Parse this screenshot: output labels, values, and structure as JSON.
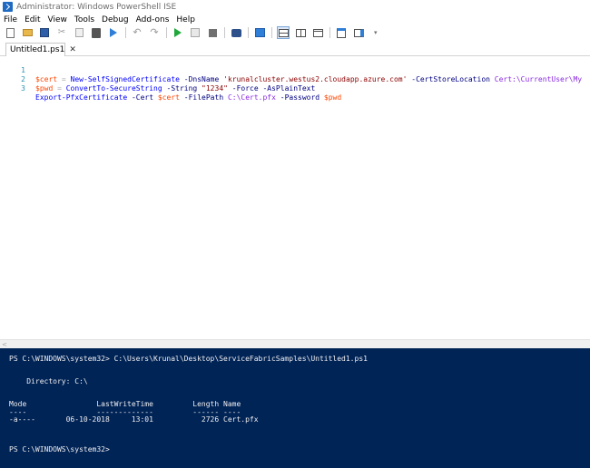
{
  "window": {
    "title": "Administrator: Windows PowerShell ISE"
  },
  "menu": [
    "File",
    "Edit",
    "View",
    "Tools",
    "Debug",
    "Add-ons",
    "Help"
  ],
  "toolbar": {
    "icons": [
      "new-file-icon",
      "open-folder-icon",
      "save-icon",
      "cut-icon",
      "copy-icon",
      "paste-icon",
      "run-selection-icon",
      "undo-icon",
      "redo-icon",
      "run-script-icon",
      "run-selection-icon",
      "stop-icon",
      "debug-icon",
      "remote-powershell-icon",
      "pane-top-icon",
      "pane-right-icon",
      "pane-max-icon",
      "command-window-icon",
      "add-on-tools-icon"
    ]
  },
  "tabs": [
    {
      "label": "Untitled1.ps1",
      "close": "✕"
    }
  ],
  "editor": {
    "lines": [
      {
        "number": "1",
        "tokens": [
          {
            "t": "$cert",
            "k": "var"
          },
          {
            "t": " = ",
            "k": "op"
          },
          {
            "t": "New-SelfSignedCertificate",
            "k": "cmd"
          },
          {
            "t": " -DnsName ",
            "k": "param"
          },
          {
            "t": "'krunalcluster.westus2.cloudapp.azure.com'",
            "k": "str"
          },
          {
            "t": " -CertStoreLocation ",
            "k": "param"
          },
          {
            "t": "Cert:\\CurrentUser\\My",
            "k": "arg"
          }
        ]
      },
      {
        "number": "2",
        "tokens": [
          {
            "t": "$pwd",
            "k": "var"
          },
          {
            "t": " = ",
            "k": "op"
          },
          {
            "t": "ConvertTo-SecureString",
            "k": "cmd"
          },
          {
            "t": " -String ",
            "k": "param"
          },
          {
            "t": "\"1234\"",
            "k": "str"
          },
          {
            "t": " -Force -AsPlainText",
            "k": "param"
          }
        ]
      },
      {
        "number": "3",
        "tokens": [
          {
            "t": "Export-PfxCertificate",
            "k": "cmd"
          },
          {
            "t": " -Cert ",
            "k": "param"
          },
          {
            "t": "$cert",
            "k": "var"
          },
          {
            "t": " -FilePath ",
            "k": "param"
          },
          {
            "t": "C:\\Cert.pfx",
            "k": "arg"
          },
          {
            "t": " -Password ",
            "k": "param"
          },
          {
            "t": "$pwd",
            "k": "var"
          }
        ]
      }
    ]
  },
  "scrollbar": {
    "left_arrow": "<"
  },
  "console": {
    "lines": [
      "PS C:\\WINDOWS\\system32> C:\\Users\\Krunal\\Desktop\\ServiceFabricSamples\\Untitled1.ps1",
      "",
      "",
      "    Directory: C:\\",
      "",
      "",
      "Mode                LastWriteTime         Length Name",
      "----                -------------         ------ ----",
      "-a----       06-10-2018     13:01           2726 Cert.pfx",
      "",
      "",
      "PS C:\\WINDOWS\\system32>"
    ]
  },
  "colors": {
    "console_bg": "#012456",
    "console_fg": "#eeedf0",
    "token_var": "#ff4500",
    "token_cmd": "#0000ff",
    "token_param": "#000080",
    "token_str": "#8b0000",
    "token_arg": "#8a2be2",
    "line_number": "#2b91af"
  }
}
